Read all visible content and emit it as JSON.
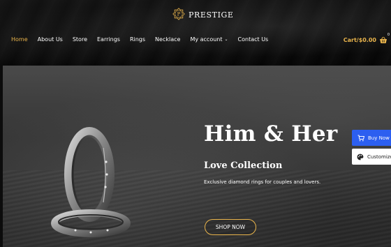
{
  "header": {
    "logo_text": "PRESTIGE",
    "logo_letter": "P",
    "nav": [
      {
        "label": "Home",
        "active": true
      },
      {
        "label": "About Us"
      },
      {
        "label": "Store"
      },
      {
        "label": "Earrings"
      },
      {
        "label": "Rings"
      },
      {
        "label": "Necklace"
      },
      {
        "label": "My account",
        "has_dropdown": true
      },
      {
        "label": "Contact Us"
      }
    ],
    "cart_label": "Cart/$0.00",
    "cart_count": "0"
  },
  "hero": {
    "title": "Him & Her",
    "subtitle": "Love Collection",
    "description": "Exclusive diamond rings for couples and lovers.",
    "cta_label": "SHOP NOW"
  },
  "side_buttons": {
    "buy_now": "Buy Now",
    "customize": "Customize"
  },
  "colors": {
    "accent": "#e9b44c",
    "buy_now_bg": "#2c5ff0"
  },
  "icons": {
    "logo": "logo-emblem-icon",
    "dropdown": "chevron-down-icon",
    "cart": "basket-icon",
    "buy_now": "cart-icon",
    "customize": "palette-icon"
  }
}
